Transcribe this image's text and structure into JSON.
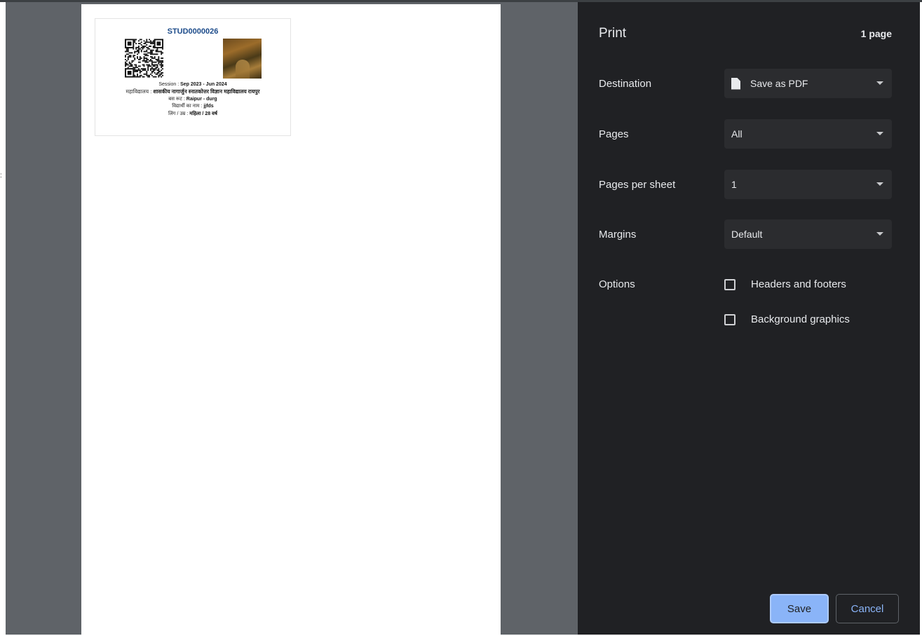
{
  "preview": {
    "card": {
      "student_id": "STUD0000026",
      "session_label": "Session : ",
      "session_value": "Sep 2023 - Jun 2024",
      "college_label": "महाविद्यालय : ",
      "college_value": "शासकीय नागार्जुन स्नातकोत्तर विज्ञान महाविद्यालय रायपुर",
      "route_label": "बस रूट : ",
      "route_value": "Raipur - durg",
      "name_label": "विद्यार्थी का नाम : ",
      "name_value": "jjfds",
      "gender_age_label": "लिंग / उम्र : ",
      "gender_age_value": "महिला / 28 वर्ष"
    }
  },
  "panel": {
    "title": "Print",
    "page_count": "1 page",
    "destination": {
      "label": "Destination",
      "value": "Save as PDF",
      "icon": "file-icon"
    },
    "pages": {
      "label": "Pages",
      "value": "All"
    },
    "pages_per_sheet": {
      "label": "Pages per sheet",
      "value": "1"
    },
    "margins": {
      "label": "Margins",
      "value": "Default"
    },
    "options": {
      "label": "Options",
      "headers_footers": {
        "label": "Headers and footers",
        "checked": false
      },
      "background_graphics": {
        "label": "Background graphics",
        "checked": false
      }
    },
    "buttons": {
      "save": "Save",
      "cancel": "Cancel"
    }
  },
  "colors": {
    "panel_bg": "#202124",
    "select_bg": "#2b2c2f",
    "accent": "#8ab4f8",
    "preview_bg": "#5f6368",
    "student_id_color": "#1c4b8a"
  }
}
